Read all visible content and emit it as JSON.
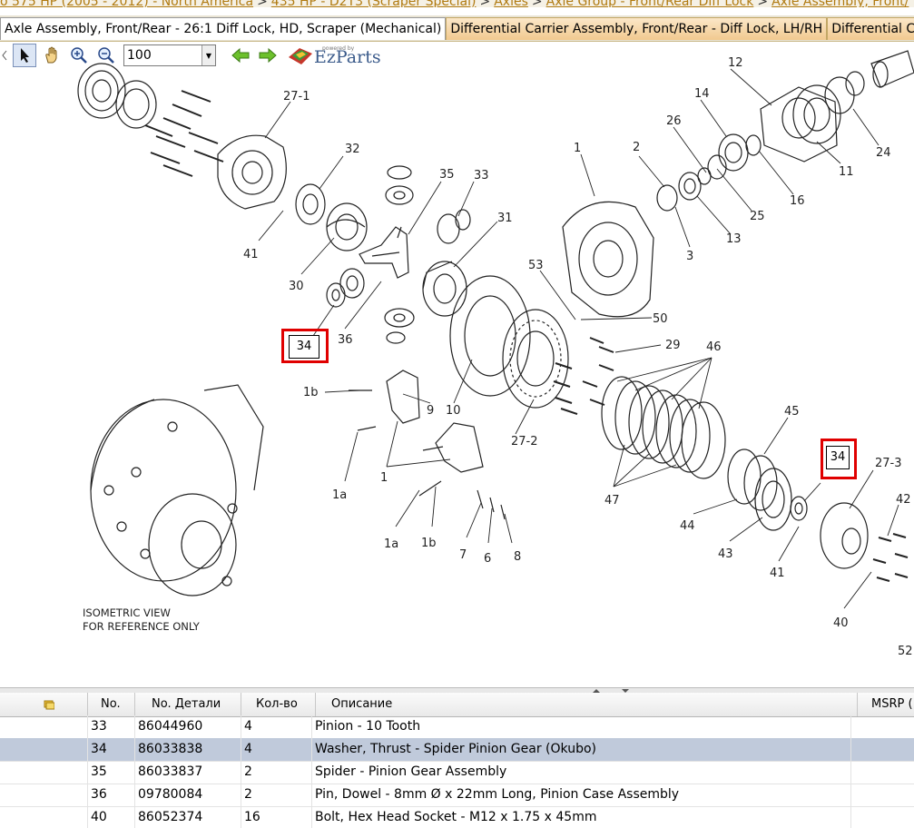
{
  "breadcrumb": [
    "o 575 HP (2005 - 2012) - North America",
    "435 HP - D2T3 (Scraper Special)",
    "Axles",
    "Axle Group - Front/Rear Diff Lock",
    "Axle Assembly, Front/"
  ],
  "tabs": [
    {
      "label": "Axle Assembly, Front/Rear - 26:1 Diff Lock, HD, Scraper (Mechanical)"
    },
    {
      "label": "Differential Carrier Assembly, Front/Rear - Diff Lock, LH/RH"
    },
    {
      "label": "Differential C"
    }
  ],
  "toolbar": {
    "zoom_value": "100",
    "logo_powered": "powered by",
    "logo_text": "EzParts"
  },
  "drawing": {
    "labels": {
      "l27_1": "27-1",
      "l32": "32",
      "l35": "35",
      "l33": "33",
      "l31": "31",
      "l41a": "41",
      "l30": "30",
      "l36": "36",
      "l34a": "34",
      "l1b_a": "1b",
      "l9": "9",
      "l10": "10",
      "l27_2": "27-2",
      "l1a_a": "1a",
      "l1": "1",
      "l1a_b": "1a",
      "l1b_b": "1b",
      "l7": "7",
      "l6": "6",
      "l8": "8",
      "l12": "12",
      "l14": "14",
      "l26": "26",
      "l1_top": "1",
      "l2": "2",
      "l3": "3",
      "l13": "13",
      "l25": "25",
      "l16": "16",
      "l11": "11",
      "l24": "24",
      "l53": "53",
      "l50": "50",
      "l29": "29",
      "l46": "46",
      "l45": "45",
      "l34b": "34",
      "l27_3": "27-3",
      "l42": "42",
      "l47": "47",
      "l44": "44",
      "l43": "43",
      "l41b": "41",
      "l40": "40",
      "l52": "52"
    },
    "iso_line1": "ISOMETRIC VIEW",
    "iso_line2": "FOR REFERENCE ONLY"
  },
  "grid": {
    "headers": {
      "no": "No.",
      "part": "No. Детали",
      "qty": "Кол-во",
      "desc": "Описание",
      "msrp": "MSRP ("
    },
    "rows": [
      {
        "no": "33",
        "part": "86044960",
        "qty": "4",
        "desc": "Pinion - 10 Tooth"
      },
      {
        "no": "34",
        "part": "86033838",
        "qty": "4",
        "desc": "Washer, Thrust - Spider Pinion Gear (Okubo)"
      },
      {
        "no": "35",
        "part": "86033837",
        "qty": "2",
        "desc": "Spider - Pinion Gear Assembly"
      },
      {
        "no": "36",
        "part": "09780084",
        "qty": "2",
        "desc": "Pin, Dowel - 8mm Ø x 22mm Long, Pinion Case Assembly"
      },
      {
        "no": "40",
        "part": "86052374",
        "qty": "16",
        "desc": "Bolt, Hex Head Socket - M12 x 1.75 x 45mm"
      }
    ],
    "selected_row": 1
  },
  "colors": {
    "highlight": "#e00000",
    "selected_row": "#c0cadb",
    "tab_inactive": "#f1c98f",
    "link": "#b07a10"
  }
}
